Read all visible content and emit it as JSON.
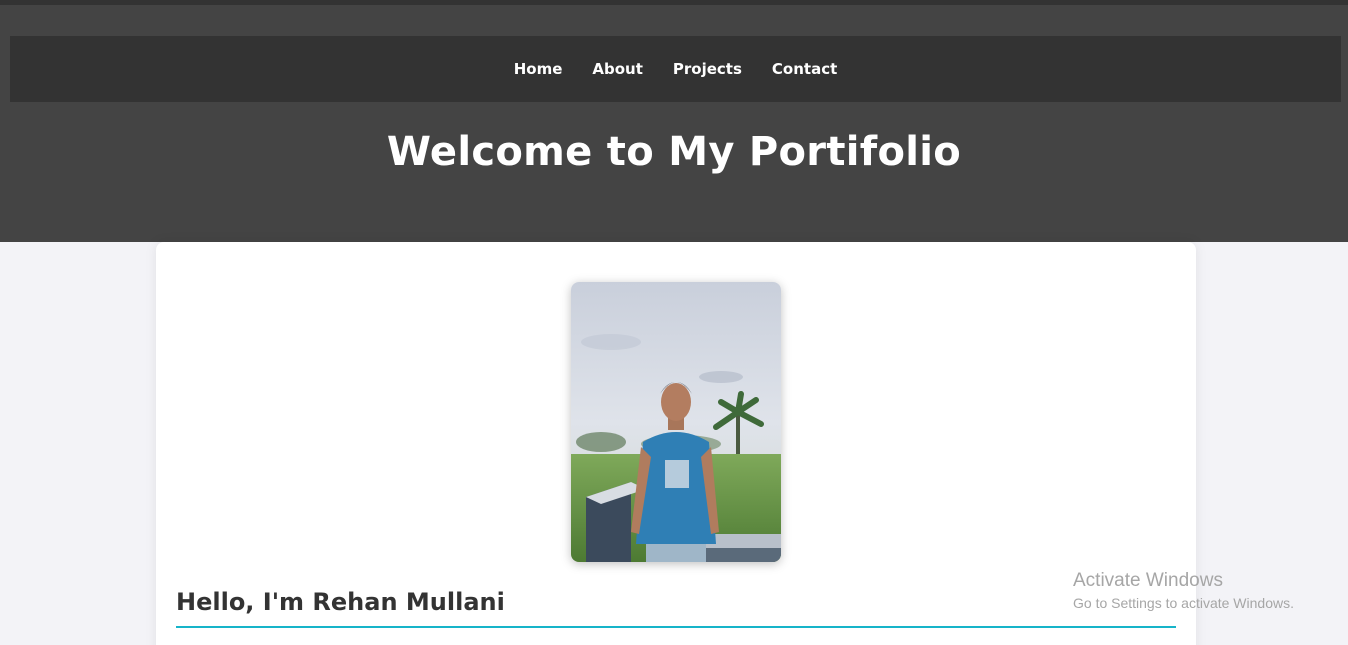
{
  "nav": {
    "items": [
      {
        "label": "Home"
      },
      {
        "label": "About"
      },
      {
        "label": "Projects"
      },
      {
        "label": "Contact"
      }
    ]
  },
  "hero": {
    "title": "Welcome to My Portifolio"
  },
  "about": {
    "photo_icon": "profile-photo",
    "heading": "Hello, I'm Rehan Mullani",
    "accent_color": "#17b4c9"
  },
  "watermark": {
    "title": "Activate Windows",
    "subtitle": "Go to Settings to activate Windows."
  }
}
